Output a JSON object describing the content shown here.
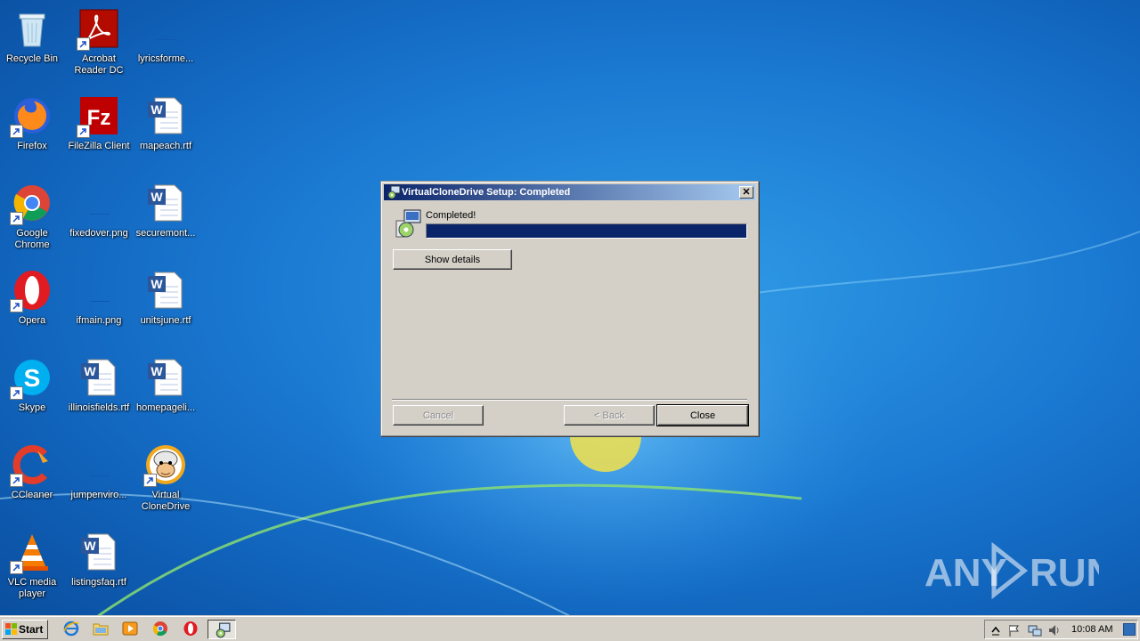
{
  "desktop_icons": [
    {
      "label": "Recycle Bin",
      "icon": "recycle-bin-icon"
    },
    {
      "label": "Acrobat Reader DC",
      "icon": "acrobat-reader-icon"
    },
    {
      "label": "lyricsforme...",
      "icon": "blank-file-icon"
    },
    {
      "label": "Firefox",
      "icon": "firefox-icon"
    },
    {
      "label": "FileZilla Client",
      "icon": "filezilla-icon"
    },
    {
      "label": "mapeach.rtf",
      "icon": "word-doc-icon"
    },
    {
      "label": "Google Chrome",
      "icon": "chrome-icon"
    },
    {
      "label": "fixedover.png",
      "icon": "blank-file-icon"
    },
    {
      "label": "securemont...",
      "icon": "word-doc-icon"
    },
    {
      "label": "Opera",
      "icon": "opera-icon"
    },
    {
      "label": "ifmain.png",
      "icon": "blank-file-icon"
    },
    {
      "label": "unitsjune.rtf",
      "icon": "word-doc-icon"
    },
    {
      "label": "Skype",
      "icon": "skype-icon"
    },
    {
      "label": "illinoisfields.rtf",
      "icon": "word-doc-icon"
    },
    {
      "label": "homepageli...",
      "icon": "word-doc-icon"
    },
    {
      "label": "CCleaner",
      "icon": "ccleaner-icon"
    },
    {
      "label": "jumpenviro...",
      "icon": "blank-file-icon"
    },
    {
      "label": "Virtual CloneDrive",
      "icon": "virtual-clonedrive-icon"
    },
    {
      "label": "VLC media player",
      "icon": "vlc-icon"
    },
    {
      "label": "listingsfaq.rtf",
      "icon": "word-doc-icon"
    }
  ],
  "dialog": {
    "title": "VirtualCloneDrive Setup: Completed",
    "close_glyph": "✕",
    "status": "Completed!",
    "progress": 1.0,
    "show_details_label": "Show details",
    "cancel_label": "Cancel",
    "back_label": "< Back",
    "close_label": "Close"
  },
  "taskbar": {
    "start_label": "Start",
    "clock": "10:08 AM",
    "pinned": [
      "internet-explorer-icon",
      "folder-icon",
      "media-player-icon",
      "chrome-icon",
      "opera-icon",
      "setup-icon"
    ]
  },
  "watermark": {
    "text": "ANY RUN"
  },
  "colors": {
    "titlebar_start": "#0a246a",
    "titlebar_end": "#a6caf0",
    "progress": "#0a246a",
    "dialog_bg": "#d4d0c8"
  }
}
